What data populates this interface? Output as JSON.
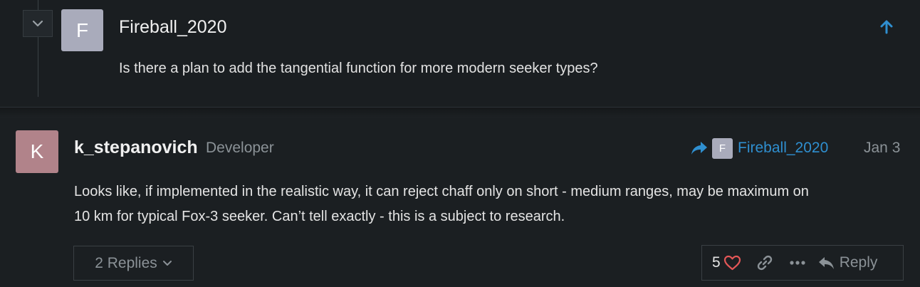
{
  "quoted_post": {
    "avatar_letter": "F",
    "username": "Fireball_2020",
    "text": "Is there a plan to add the tangential function for more modern seeker types?"
  },
  "post": {
    "avatar_letter": "K",
    "username": "k_stepanovich",
    "role": "Developer",
    "reply_to": {
      "avatar_letter": "F",
      "username": "Fireball_2020"
    },
    "date": "Jan 3",
    "body_lines": [
      "Looks like, if implemented in the realistic way, it can reject chaff only on short - medium ranges, may be maximum on",
      "10 km for typical Fox-3 seeker. Can’t tell exactly - this is a subject to research."
    ],
    "replies_label": "2 Replies",
    "like_count": "5",
    "reply_label": "Reply"
  },
  "colors": {
    "background": "#1b1f22",
    "accent_blue": "#2f8fd0",
    "heart_red": "#e45757",
    "avatar_f": "#a9abbb",
    "avatar_k": "#b1838a"
  }
}
